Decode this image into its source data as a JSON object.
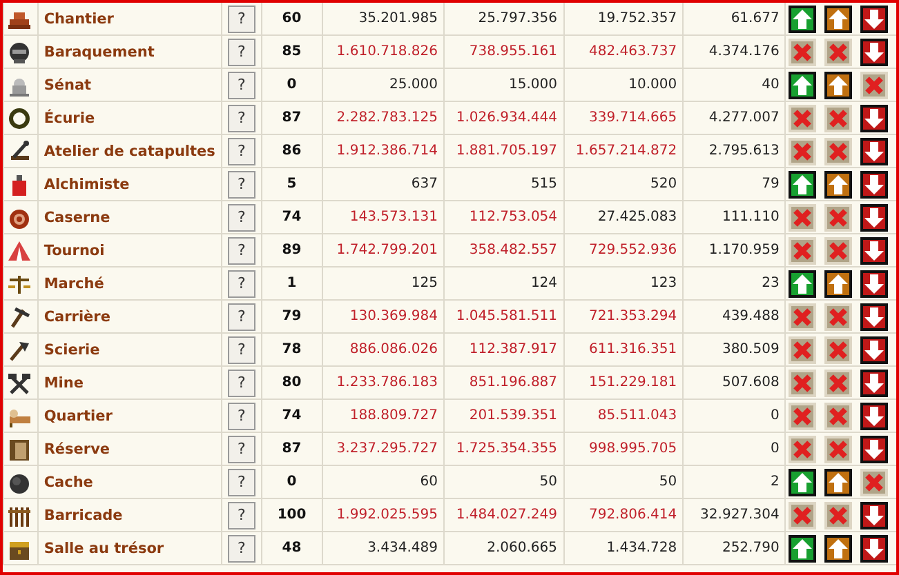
{
  "buildings": [
    {
      "name": "Chantier",
      "help": "?",
      "level": "60",
      "costs": [
        {
          "value": "35.201.985",
          "short": false
        },
        {
          "value": "25.797.356",
          "short": false
        },
        {
          "value": "19.752.357",
          "short": false
        }
      ],
      "extra": "61.677",
      "upgrade": true,
      "premium": true,
      "demolish": true
    },
    {
      "name": "Baraquement",
      "help": "?",
      "level": "85",
      "costs": [
        {
          "value": "1.610.718.826",
          "short": true
        },
        {
          "value": "738.955.161",
          "short": true
        },
        {
          "value": "482.463.737",
          "short": true
        }
      ],
      "extra": "4.374.176",
      "upgrade": false,
      "premium": false,
      "demolish": true
    },
    {
      "name": "Sénat",
      "help": "?",
      "level": "0",
      "costs": [
        {
          "value": "25.000",
          "short": false
        },
        {
          "value": "15.000",
          "short": false
        },
        {
          "value": "10.000",
          "short": false
        }
      ],
      "extra": "40",
      "upgrade": true,
      "premium": true,
      "demolish": false
    },
    {
      "name": "Écurie",
      "help": "?",
      "level": "87",
      "costs": [
        {
          "value": "2.282.783.125",
          "short": true
        },
        {
          "value": "1.026.934.444",
          "short": true
        },
        {
          "value": "339.714.665",
          "short": true
        }
      ],
      "extra": "4.277.007",
      "upgrade": false,
      "premium": false,
      "demolish": true
    },
    {
      "name": "Atelier de catapultes",
      "help": "?",
      "level": "86",
      "costs": [
        {
          "value": "1.912.386.714",
          "short": true
        },
        {
          "value": "1.881.705.197",
          "short": true
        },
        {
          "value": "1.657.214.872",
          "short": true
        }
      ],
      "extra": "2.795.613",
      "upgrade": false,
      "premium": false,
      "demolish": true
    },
    {
      "name": "Alchimiste",
      "help": "?",
      "level": "5",
      "costs": [
        {
          "value": "637",
          "short": false
        },
        {
          "value": "515",
          "short": false
        },
        {
          "value": "520",
          "short": false
        }
      ],
      "extra": "79",
      "upgrade": true,
      "premium": true,
      "demolish": true
    },
    {
      "name": "Caserne",
      "help": "?",
      "level": "74",
      "costs": [
        {
          "value": "143.573.131",
          "short": true
        },
        {
          "value": "112.753.054",
          "short": true
        },
        {
          "value": "27.425.083",
          "short": false
        }
      ],
      "extra": "111.110",
      "upgrade": false,
      "premium": false,
      "demolish": true
    },
    {
      "name": "Tournoi",
      "help": "?",
      "level": "89",
      "costs": [
        {
          "value": "1.742.799.201",
          "short": true
        },
        {
          "value": "358.482.557",
          "short": true
        },
        {
          "value": "729.552.936",
          "short": true
        }
      ],
      "extra": "1.170.959",
      "upgrade": false,
      "premium": false,
      "demolish": true
    },
    {
      "name": "Marché",
      "help": "?",
      "level": "1",
      "costs": [
        {
          "value": "125",
          "short": false
        },
        {
          "value": "124",
          "short": false
        },
        {
          "value": "123",
          "short": false
        }
      ],
      "extra": "23",
      "upgrade": true,
      "premium": true,
      "demolish": true
    },
    {
      "name": "Carrière",
      "help": "?",
      "level": "79",
      "costs": [
        {
          "value": "130.369.984",
          "short": true
        },
        {
          "value": "1.045.581.511",
          "short": true
        },
        {
          "value": "721.353.294",
          "short": true
        }
      ],
      "extra": "439.488",
      "upgrade": false,
      "premium": false,
      "demolish": true
    },
    {
      "name": "Scierie",
      "help": "?",
      "level": "78",
      "costs": [
        {
          "value": "886.086.026",
          "short": true
        },
        {
          "value": "112.387.917",
          "short": true
        },
        {
          "value": "611.316.351",
          "short": true
        }
      ],
      "extra": "380.509",
      "upgrade": false,
      "premium": false,
      "demolish": true
    },
    {
      "name": "Mine",
      "help": "?",
      "level": "80",
      "costs": [
        {
          "value": "1.233.786.183",
          "short": true
        },
        {
          "value": "851.196.887",
          "short": true
        },
        {
          "value": "151.229.181",
          "short": true
        }
      ],
      "extra": "507.608",
      "upgrade": false,
      "premium": false,
      "demolish": true
    },
    {
      "name": "Quartier",
      "help": "?",
      "level": "74",
      "costs": [
        {
          "value": "188.809.727",
          "short": true
        },
        {
          "value": "201.539.351",
          "short": true
        },
        {
          "value": "85.511.043",
          "short": true
        }
      ],
      "extra": "0",
      "upgrade": false,
      "premium": false,
      "demolish": true
    },
    {
      "name": "Réserve",
      "help": "?",
      "level": "87",
      "costs": [
        {
          "value": "3.237.295.727",
          "short": true
        },
        {
          "value": "1.725.354.355",
          "short": true
        },
        {
          "value": "998.995.705",
          "short": true
        }
      ],
      "extra": "0",
      "upgrade": false,
      "premium": false,
      "demolish": true
    },
    {
      "name": "Cache",
      "help": "?",
      "level": "0",
      "costs": [
        {
          "value": "60",
          "short": false
        },
        {
          "value": "50",
          "short": false
        },
        {
          "value": "50",
          "short": false
        }
      ],
      "extra": "2",
      "upgrade": true,
      "premium": true,
      "demolish": false
    },
    {
      "name": "Barricade",
      "help": "?",
      "level": "100",
      "costs": [
        {
          "value": "1.992.025.595",
          "short": true
        },
        {
          "value": "1.484.027.249",
          "short": true
        },
        {
          "value": "792.806.414",
          "short": true
        }
      ],
      "extra": "32.927.304",
      "upgrade": false,
      "premium": false,
      "demolish": true
    },
    {
      "name": "Salle au trésor",
      "help": "?",
      "level": "48",
      "costs": [
        {
          "value": "3.434.489",
          "short": false
        },
        {
          "value": "2.060.665",
          "short": false
        },
        {
          "value": "1.434.728",
          "short": false
        }
      ],
      "extra": "252.790",
      "upgrade": true,
      "premium": true,
      "demolish": true
    }
  ]
}
